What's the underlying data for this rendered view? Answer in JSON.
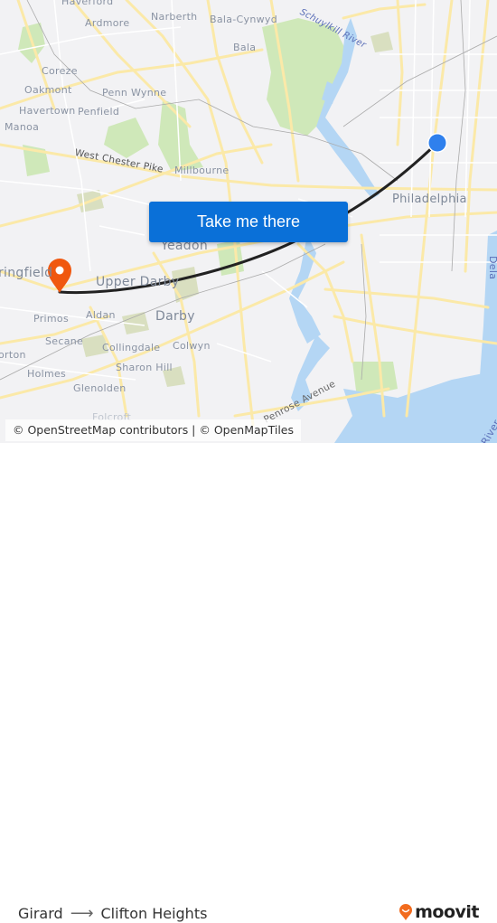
{
  "map": {
    "labels": {
      "haverford": "Haverford",
      "narberth": "Narberth",
      "bala_cynwyd": "Bala-Cynwyd",
      "ardmore": "Ardmore",
      "bala": "Bala",
      "schuylkill_river": "Schuylkill River",
      "coreze": "Coreze",
      "oakmont": "Oakmont",
      "penn_wynne": "Penn Wynne",
      "havertown": "Havertown",
      "penfield": "Penfield",
      "manoa": "Manoa",
      "west_chester_pike": "West Chester Pike",
      "millbourne": "Millbourne",
      "philadelphia": "Philadelphia",
      "yeadon": "Yeadon",
      "springfield": "ringfield",
      "upper_darby": "Upper Darby",
      "primos": "Primos",
      "aldan": "Aldan",
      "darby": "Darby",
      "secane": "Secane",
      "collingdale": "Collingdale",
      "colwyn": "Colwyn",
      "morton": "orton",
      "holmes": "Holmes",
      "sharon_hill": "Sharon Hill",
      "glenolden": "Glenolden",
      "folcroft": "Folcroft",
      "penrose_avenue": "Penrose Avenue",
      "delaware": "Dela",
      "river": "River"
    },
    "origin_color": "#2f80ed",
    "destination_color": "#f0580f",
    "route_color": "#222222",
    "cta_label": "Take me there",
    "cta_color": "#0a70d8",
    "attribution": "© OpenStreetMap contributors | © OpenMapTiles"
  },
  "footer": {
    "origin": "Girard",
    "arrow": "⟶",
    "destination": "Clifton Heights",
    "brand": "moovit",
    "brand_color": "#f26b1d"
  }
}
